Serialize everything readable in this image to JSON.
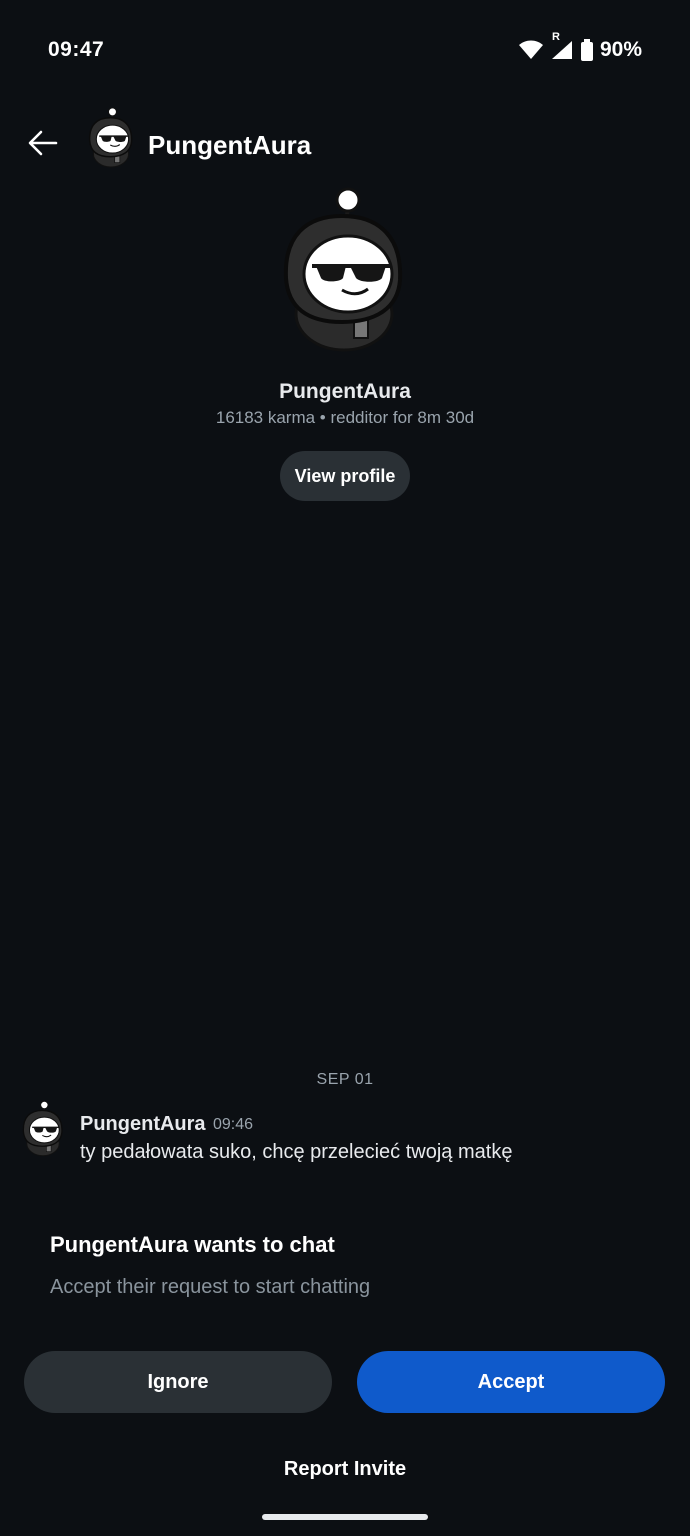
{
  "status_bar": {
    "time": "09:47",
    "network_label": "R",
    "battery": "90%"
  },
  "header": {
    "title": "PungentAura",
    "back_icon": "arrow-left-icon"
  },
  "profile": {
    "username": "PungentAura",
    "meta": "16183 karma • redditor for 8m 30d",
    "view_profile_label": "View profile"
  },
  "conversation": {
    "date_separator": "SEP 01",
    "messages": [
      {
        "author": "PungentAura",
        "time": "09:46",
        "text": "ty pedałowata suko, chcę przelecieć twoją matkę"
      }
    ]
  },
  "invite": {
    "title": "PungentAura wants to chat",
    "subtitle": "Accept their request to start chatting",
    "ignore_label": "Ignore",
    "accept_label": "Accept",
    "report_label": "Report Invite"
  },
  "colors": {
    "background": "#0c0f13",
    "accept_button": "#0f5acb",
    "secondary_button": "#2a3035",
    "muted_text": "#9aa4ad"
  }
}
